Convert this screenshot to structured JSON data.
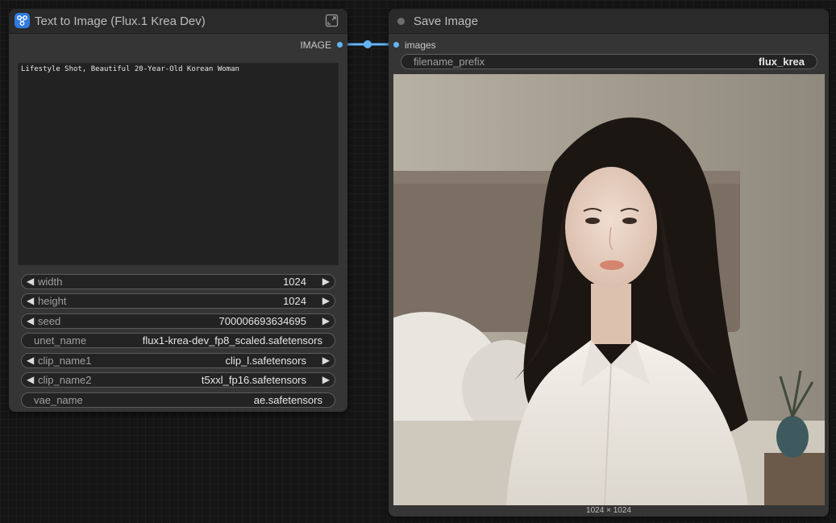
{
  "text_to_image_node": {
    "title": "Text to Image (Flux.1 Krea Dev)",
    "output_label": "IMAGE",
    "prompt": "Lifestyle Shot, Beautiful 20-Year-Old Korean Woman",
    "widgets": {
      "width": {
        "label": "width",
        "value": "1024"
      },
      "height": {
        "label": "height",
        "value": "1024"
      },
      "seed": {
        "label": "seed",
        "value": "700006693634695"
      },
      "unet_name": {
        "label": "unet_name",
        "value": "flux1-krea-dev_fp8_scaled.safetensors"
      },
      "clip_name1": {
        "label": "clip_name1",
        "value": "clip_l.safetensors"
      },
      "clip_name2": {
        "label": "clip_name2",
        "value": "t5xxl_fp16.safetensors"
      },
      "vae_name": {
        "label": "vae_name",
        "value": "ae.safetensors"
      }
    }
  },
  "save_image_node": {
    "title": "Save Image",
    "input_label": "images",
    "filename_prefix": {
      "label": "filename_prefix",
      "value": "flux_krea"
    },
    "preview_dimensions": "1024 × 1024"
  },
  "icons": {
    "left_arrow": "◀",
    "right_arrow": "▶"
  },
  "colors": {
    "link": "#64b5f6",
    "app_badge": "#2f7be0",
    "node_bg": "#353535"
  }
}
